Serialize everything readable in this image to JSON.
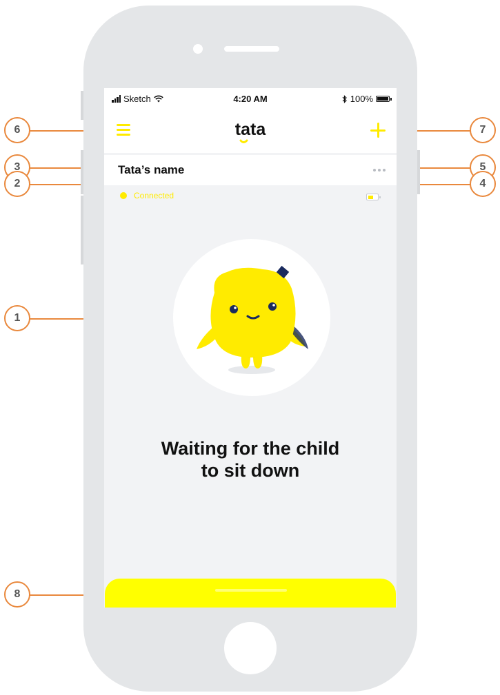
{
  "status_bar": {
    "carrier": "Sketch",
    "time": "4:20 AM",
    "battery_percent": "100%"
  },
  "nav": {
    "logo_text": "tata"
  },
  "device": {
    "name": "Tata’s name",
    "connection_status": "Connected",
    "battery_level": 0.6
  },
  "main": {
    "message_line1": "Waiting for the child",
    "message_line2": "to sit down"
  },
  "callouts": [
    "1",
    "2",
    "3",
    "4",
    "5",
    "6",
    "7",
    "8"
  ],
  "colors": {
    "accent_yellow": "#ffeb00",
    "callout_orange": "#e9883c",
    "screen_bg": "#f2f3f5",
    "mascot_navy": "#1a2a5e"
  },
  "icons": [
    "signal-icon",
    "wifi-icon",
    "bluetooth-icon",
    "battery-icon",
    "menu-icon",
    "plus-icon",
    "more-dots-icon",
    "device-battery-icon",
    "mascot-illustration"
  ]
}
